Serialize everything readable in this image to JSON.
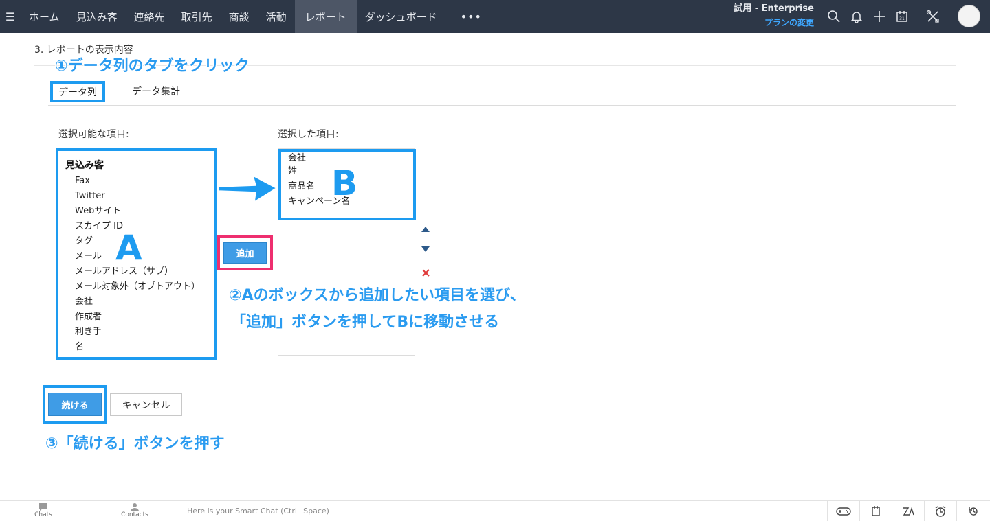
{
  "topnav": {
    "items": [
      "ホーム",
      "見込み客",
      "連絡先",
      "取引先",
      "商談",
      "活動",
      "レポート",
      "ダッシュボード"
    ],
    "active": "レポート",
    "more": "•••"
  },
  "trial": {
    "title": "試用 - Enterprise",
    "link": "プランの変更"
  },
  "section": {
    "heading": "3.  レポートの表示内容"
  },
  "tabs": {
    "columns": "データ列",
    "aggregate": "データ集計"
  },
  "available": {
    "label": "選択可能な項目:",
    "group": "見込み客",
    "items": [
      "Fax",
      "Twitter",
      "Webサイト",
      "スカイプ ID",
      "タグ",
      "メール",
      "メールアドレス（サブ）",
      "メール対象外（オプトアウト）",
      "会社",
      "作成者",
      "利き手",
      "名"
    ]
  },
  "selected": {
    "label": "選択した項目:",
    "items": [
      "会社",
      "姓",
      "商品名",
      "キャンペーン名"
    ]
  },
  "buttons": {
    "add": "追加",
    "continue": "続ける",
    "cancel": "キャンセル"
  },
  "annotations": {
    "step1": "①データ列のタブをクリック",
    "step2_line1": "②Aのボックスから追加したい項目を選び、",
    "step2_line2": "「追加」ボタンを押してBに移動させる",
    "step3": "③「続ける」ボタンを押す",
    "letter_a": "A",
    "letter_b": "B"
  },
  "bottombar": {
    "chats": "Chats",
    "contacts": "Contacts",
    "smartchat_placeholder": "Here is your Smart Chat (Ctrl+Space)"
  },
  "colors": {
    "topbar": "#2d3747",
    "highlight_blue": "#1d9bf0",
    "highlight_pink": "#ee2f6f",
    "button_blue": "#3f9ce6"
  }
}
